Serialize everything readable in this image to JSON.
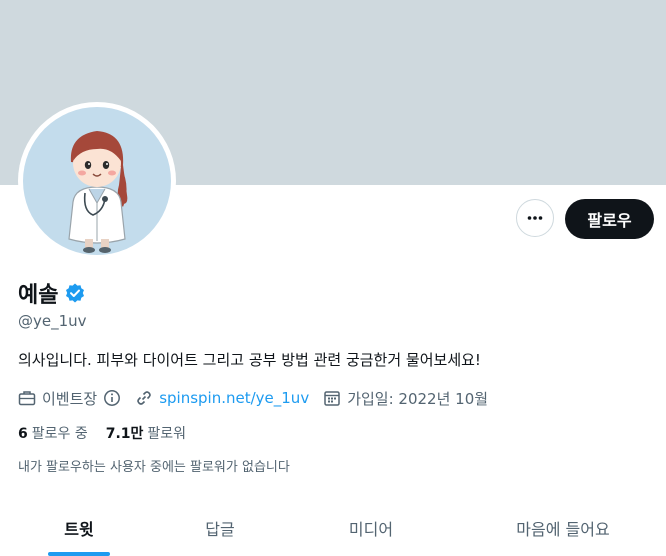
{
  "profile": {
    "name": "예솔",
    "handle": "@ye_1uv",
    "bio": "의사입니다. 피부와 다이어트 그리고 공부 방법 관련 궁금한거 물어보세요!",
    "verified": true
  },
  "actions": {
    "follow_label": "팔로우",
    "more_icon": "more-icon"
  },
  "meta": {
    "category": "이벤트장",
    "website": "spinspin.net/ye_1uv",
    "joined": "가입일: 2022년 10월"
  },
  "stats": {
    "following_count": "6",
    "following_label": "팔로우 중",
    "followers_count": "7.1만",
    "followers_label": "팔로워"
  },
  "followed_by_note": "내가 팔로우하는 사용자 중에는 팔로워가 없습니다",
  "tabs": [
    {
      "label": "트윗",
      "active": true
    },
    {
      "label": "답글",
      "active": false
    },
    {
      "label": "미디어",
      "active": false
    },
    {
      "label": "마음에 들어요",
      "active": false
    }
  ],
  "colors": {
    "accent": "#1d9bf0",
    "banner": "#cfd9de",
    "text": "#0f1419",
    "muted": "#536471"
  }
}
